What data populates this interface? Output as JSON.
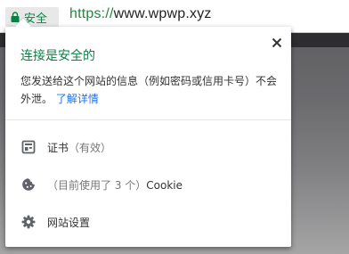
{
  "omnibox": {
    "secure_label": "安全",
    "url_scheme": "https://",
    "url_host": "www.wpwp.xyz"
  },
  "popup": {
    "title": "连接是安全的",
    "description": "您发送给这个网站的信息（例如密码或信用卡号）不会外泄。",
    "learn_more": "了解详情",
    "rows": [
      {
        "icon": "certificate-icon",
        "label": "证书",
        "detail": "（有效）"
      },
      {
        "icon": "cookie-icon",
        "label": "",
        "detail": "（目前使用了 3 个）",
        "suffix": "Cookie"
      },
      {
        "icon": "gear-icon",
        "label": "网站设置",
        "detail": ""
      }
    ]
  },
  "colors": {
    "secure_green": "#0b8043",
    "link_blue": "#1a73e8"
  }
}
